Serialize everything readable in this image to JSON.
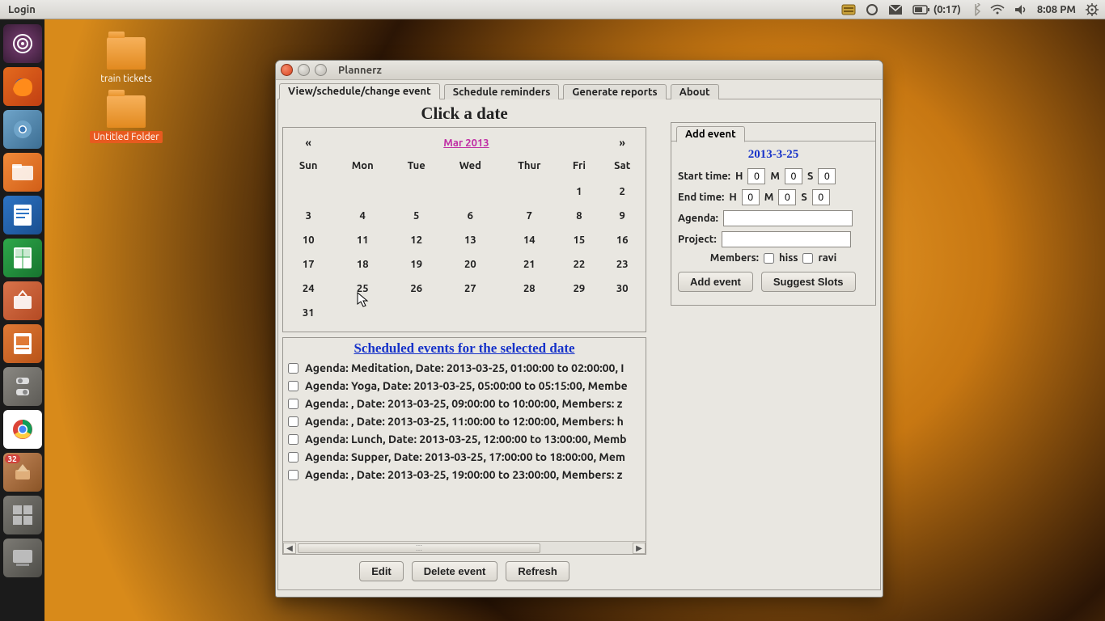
{
  "top_panel": {
    "app_menu": "Login",
    "battery": "(0:17)",
    "clock": "8:08 PM"
  },
  "desktop": {
    "icon1_label": "train tickets",
    "icon2_label": "Untitled Folder"
  },
  "launcher": {
    "updates_badge": "32"
  },
  "window": {
    "title": "Plannerz",
    "tabs": {
      "t1": "View/schedule/change event",
      "t2": "Schedule reminders",
      "t3": "Generate reports",
      "t4": "About"
    },
    "click_date_title": "Click a date",
    "calendar": {
      "prev": "«",
      "next": "»",
      "month_label": "Mar 2013",
      "dow": {
        "sun": "Sun",
        "mon": "Mon",
        "tue": "Tue",
        "wed": "Wed",
        "thu": "Thur",
        "fri": "Fri",
        "sat": "Sat"
      },
      "cells": {
        "r0c5": "1",
        "r0c6": "2",
        "r1c0": "3",
        "r1c1": "4",
        "r1c2": "5",
        "r1c3": "6",
        "r1c4": "7",
        "r1c5": "8",
        "r1c6": "9",
        "r2c0": "10",
        "r2c1": "11",
        "r2c2": "12",
        "r2c3": "13",
        "r2c4": "14",
        "r2c5": "15",
        "r2c6": "16",
        "r3c0": "17",
        "r3c1": "18",
        "r3c2": "19",
        "r3c3": "20",
        "r3c4": "21",
        "r3c5": "22",
        "r3c6": "23",
        "r4c0": "24",
        "r4c1": "25",
        "r4c2": "26",
        "r4c3": "27",
        "r4c4": "28",
        "r4c5": "29",
        "r4c6": "30",
        "r5c0": "31"
      }
    },
    "add_event": {
      "tab_label": "Add event",
      "date": "2013-3-25",
      "start_label": "Start time:",
      "end_label": "End time:",
      "H": "H",
      "M": "M",
      "S": "S",
      "start_h": "0",
      "start_m": "0",
      "start_s": "0",
      "end_h": "0",
      "end_m": "0",
      "end_s": "0",
      "agenda_label": "Agenda:",
      "agenda_value": "",
      "project_label": "Project:",
      "project_value": "",
      "members_label": "Members:",
      "member1": "hiss",
      "member2": "ravi",
      "add_btn": "Add event",
      "suggest_btn": "Suggest Slots"
    },
    "scheduled": {
      "title": "Scheduled events for the selected date",
      "items": {
        "e0": "Agenda: Meditation, Date: 2013-03-25, 01:00:00 to 02:00:00, I",
        "e1": "Agenda: Yoga, Date: 2013-03-25, 05:00:00 to 05:15:00, Membe",
        "e2": "Agenda: , Date: 2013-03-25, 09:00:00 to 10:00:00, Members: z",
        "e3": "Agenda: , Date: 2013-03-25, 11:00:00 to 12:00:00, Members: h",
        "e4": "Agenda: Lunch, Date: 2013-03-25, 12:00:00 to 13:00:00, Memb",
        "e5": "Agenda: Supper, Date: 2013-03-25, 17:00:00 to 18:00:00, Mem",
        "e6": "Agenda: , Date: 2013-03-25, 19:00:00 to 23:00:00, Members: z"
      },
      "edit_btn": "Edit",
      "delete_btn": "Delete event",
      "refresh_btn": "Refresh"
    }
  }
}
